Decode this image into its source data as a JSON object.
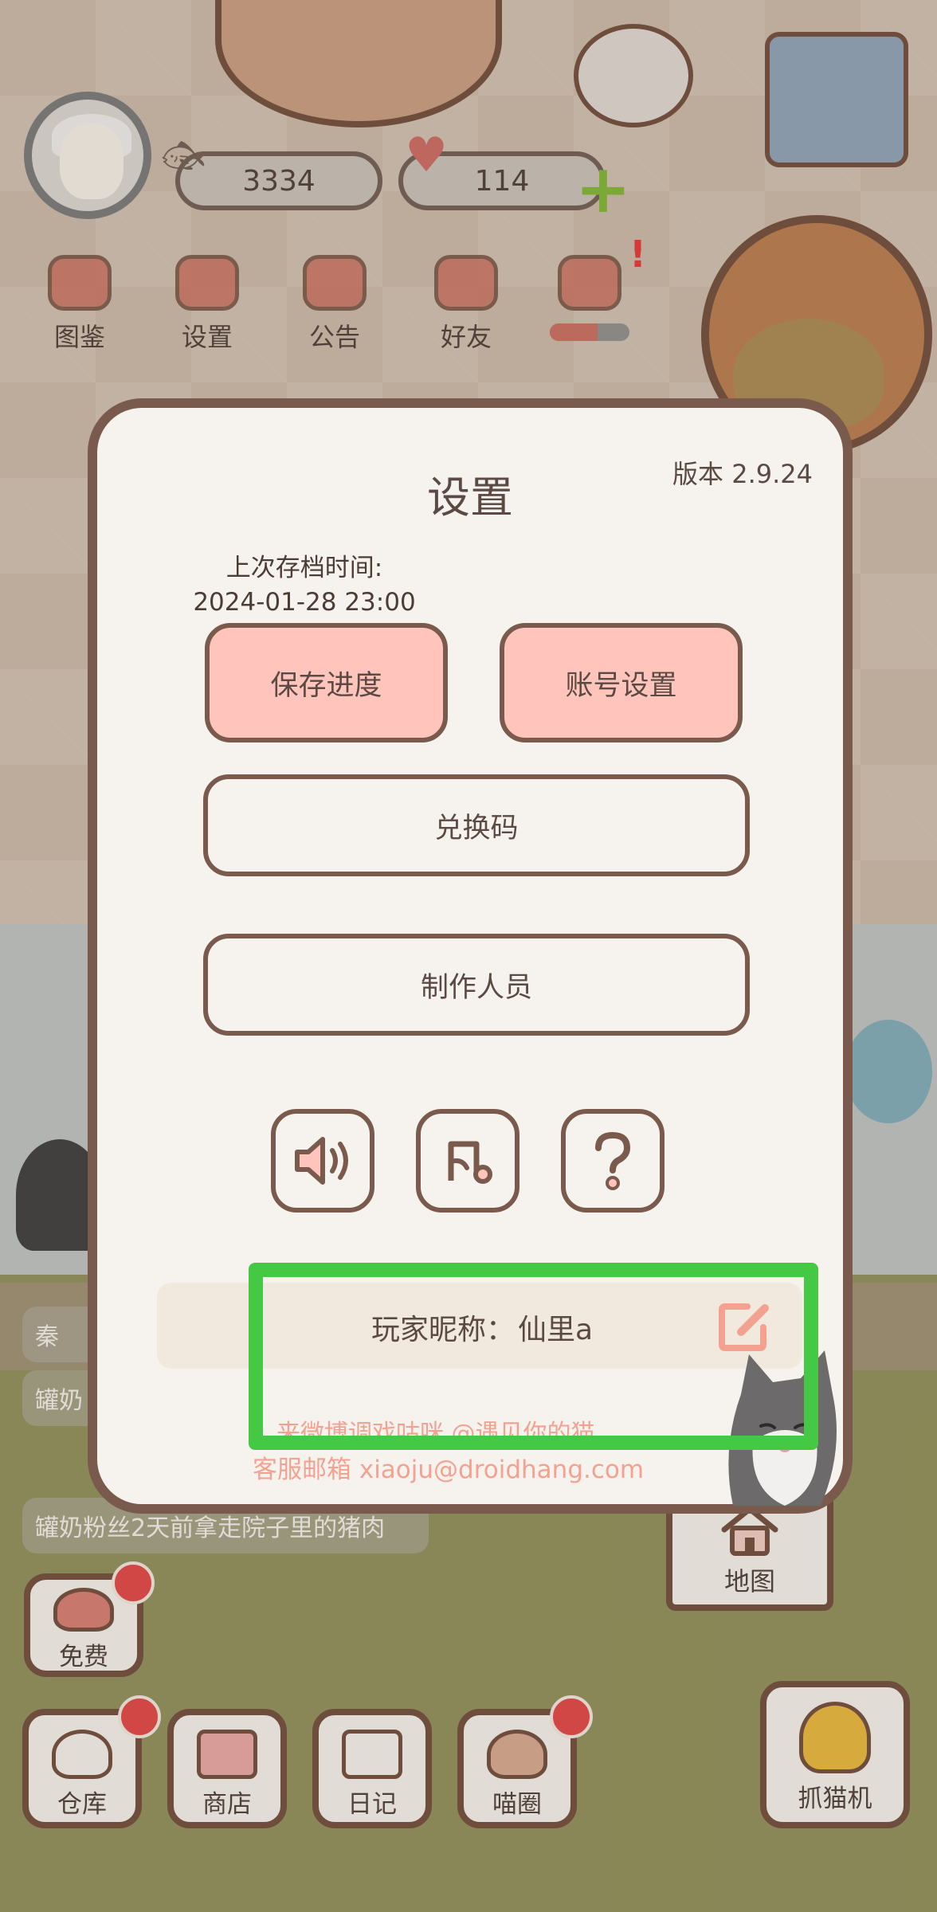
{
  "hud": {
    "fish_count": "3334",
    "heart_count": "114"
  },
  "top_menu": {
    "items": [
      {
        "label": "图鉴",
        "icon": "cat-book-icon"
      },
      {
        "label": "设置",
        "icon": "gear-icon"
      },
      {
        "label": "公告",
        "icon": "gift-icon"
      },
      {
        "label": "好友",
        "icon": "friends-icon"
      }
    ],
    "event_progress": 0.6
  },
  "settings": {
    "title": "设置",
    "version": "版本 2.9.24",
    "last_save_label": "上次存档时间:",
    "last_save_time": "2024-01-28 23:00",
    "save_button": "保存进度",
    "account_button": "账号设置",
    "redeem_button": "兑换码",
    "credits_button": "制作人员",
    "icon_buttons": [
      "speaker-icon",
      "music-note-icon",
      "question-icon"
    ],
    "nickname_label": "玩家昵称：",
    "nickname_value": "仙里a",
    "weibo_text": "来微博调戏咕咪 @遇见你的猫",
    "email_text": "客服邮箱 xiaoju@droidhang.com"
  },
  "feed": {
    "items": [
      "秦",
      "罐奶",
      "",
      "罐奶粉丝2天前拿走院子里的猪肉"
    ]
  },
  "bottom_nav": {
    "free": "免费",
    "store": "仓库",
    "shop": "商店",
    "diary": "日记",
    "circle": "喵圈",
    "claw": "抓猫机",
    "map": "地图"
  },
  "colors": {
    "panel_border": "#7a5a4d",
    "pink_button": "#ffc4bb",
    "highlight": "#45c945",
    "link_text": "#f3a291"
  }
}
